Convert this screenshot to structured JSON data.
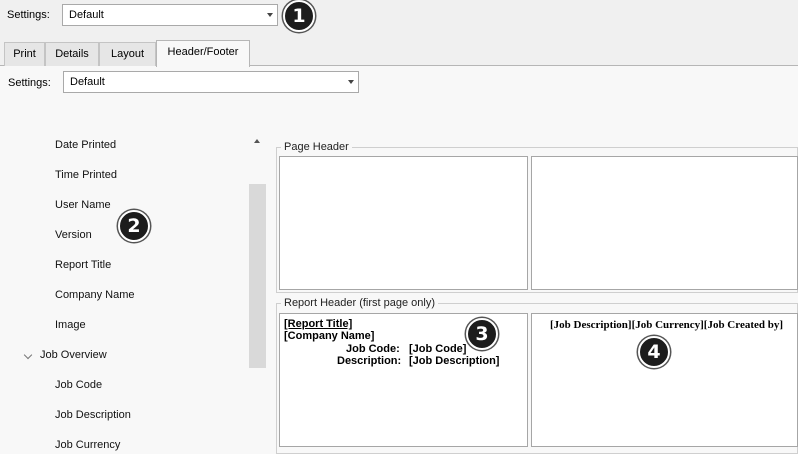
{
  "top_settings": {
    "label": "Settings:",
    "value": "Default"
  },
  "badges": [
    "1",
    "2",
    "3",
    "4"
  ],
  "tabs": [
    {
      "label": "Print"
    },
    {
      "label": "Details"
    },
    {
      "label": "Layout"
    },
    {
      "label": "Header/Footer",
      "active": true
    }
  ],
  "panel_settings": {
    "label": "Settings:",
    "value": "Default"
  },
  "tree": {
    "items": [
      "Date Printed",
      "Time Printed",
      "User Name",
      "Version",
      "Report Title",
      "Company Name",
      "Image"
    ],
    "group": "Job Overview",
    "group_items": [
      "Job Code",
      "Job Description",
      "Job Currency"
    ]
  },
  "page_header": {
    "title": "Page Header"
  },
  "report_header": {
    "title": "Report Header (first page only)",
    "left": {
      "line1": "[Report Title]",
      "line2": "[Company Name]",
      "job_code_label": "Job Code:",
      "job_code_value": "[Job Code]",
      "description_label": "Description:",
      "description_value": "[Job Description]"
    },
    "right": {
      "line1": "[Job Description][Job Currency][Job Created by]"
    }
  },
  "colors": {
    "badge_bg": "#1c1c1c",
    "panel_bg": "#f8f8f8",
    "window_bg": "#f0f0f0"
  }
}
